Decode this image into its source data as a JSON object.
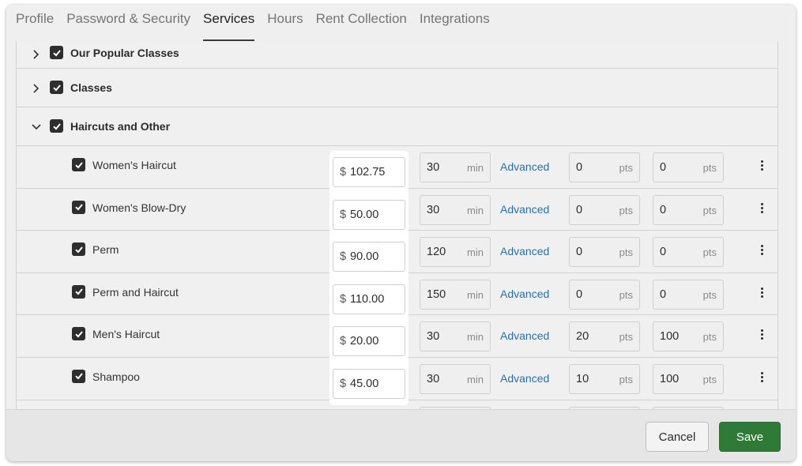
{
  "tabs": [
    {
      "label": "Profile"
    },
    {
      "label": "Password & Security"
    },
    {
      "label": "Services"
    },
    {
      "label": "Hours"
    },
    {
      "label": "Rent Collection"
    },
    {
      "label": "Integrations"
    }
  ],
  "active_tab": "Services",
  "groups": [
    {
      "label": "Our Popular Classes",
      "expanded": false,
      "checked": true
    },
    {
      "label": "Classes",
      "expanded": false,
      "checked": true
    },
    {
      "label": "Haircuts and Other",
      "expanded": true,
      "checked": true
    }
  ],
  "units": {
    "currency": "$",
    "duration": "min",
    "points": "pts",
    "advanced": "Advanced"
  },
  "services": [
    {
      "name": "Women's Haircut",
      "price": "102.75",
      "duration": "30",
      "pts1": "0",
      "pts2": "0"
    },
    {
      "name": "Women's Blow-Dry",
      "price": "50.00",
      "duration": "30",
      "pts1": "0",
      "pts2": "0"
    },
    {
      "name": "Perm",
      "price": "90.00",
      "duration": "120",
      "pts1": "0",
      "pts2": "0"
    },
    {
      "name": "Perm and Haircut",
      "price": "110.00",
      "duration": "150",
      "pts1": "0",
      "pts2": "0"
    },
    {
      "name": "Men's Haircut",
      "price": "20.00",
      "duration": "30",
      "pts1": "20",
      "pts2": "100"
    },
    {
      "name": "Shampoo",
      "price": "45.00",
      "duration": "30",
      "pts1": "10",
      "pts2": "100"
    }
  ],
  "footer": {
    "cancel_label": "Cancel",
    "save_label": "Save"
  },
  "colors": {
    "save_button": "#2f7a37",
    "link": "#2a6fa8",
    "checkbox": "#2e2e2e"
  }
}
